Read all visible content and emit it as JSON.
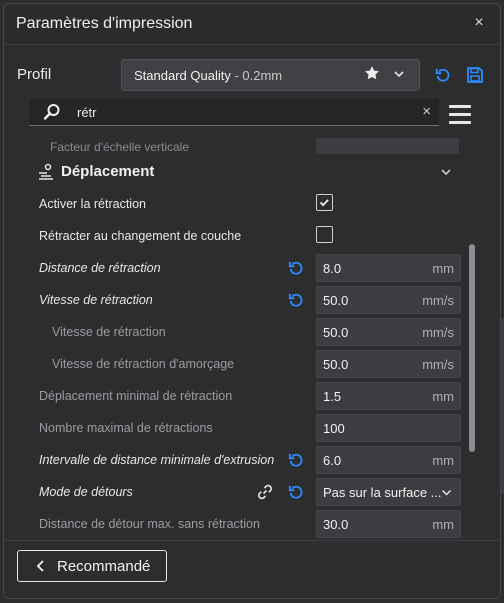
{
  "window": {
    "title": "Paramètres d'impression",
    "close_glyph": "×"
  },
  "profile": {
    "label": "Profil",
    "selected_name": "Standard Quality",
    "selected_suffix": " - 0.2mm",
    "icons": [
      "star-icon",
      "chevron-down-icon",
      "reset-icon",
      "save-icon"
    ]
  },
  "search": {
    "value": "rétr",
    "clear_glyph": "×"
  },
  "list": {
    "cut_off_label": "Facteur d'échelle verticale",
    "section_title": "Déplacement",
    "rows": [
      {
        "label": "Activer la rétraction",
        "checked": true
      },
      {
        "label": "Rétracter au changement de couche",
        "checked": false
      },
      {
        "label": "Distance de rétraction",
        "value": "8.0",
        "unit": "mm"
      },
      {
        "label": "Vitesse de rétraction",
        "value": "50.0",
        "unit": "mm/s"
      },
      {
        "label": "Vitesse de rétraction",
        "value": "50.0",
        "unit": "mm/s"
      },
      {
        "label": "Vitesse de rétraction d'amorçage",
        "value": "50.0",
        "unit": "mm/s"
      },
      {
        "label": "Déplacement minimal de rétraction",
        "value": "1.5",
        "unit": "mm"
      },
      {
        "label": "Nombre maximal de rétractions",
        "value": "100",
        "unit": ""
      },
      {
        "label": "Intervalle de distance minimale d'extrusion",
        "value": "6.0",
        "unit": "mm"
      },
      {
        "label": "Mode de détours",
        "value": "Pas sur la surface ..."
      },
      {
        "label": "Distance de détour max. sans rétraction",
        "value": "30.0",
        "unit": "mm"
      }
    ]
  },
  "footer": {
    "recommended_label": "Recommandé"
  },
  "colors": {
    "accent": "#2f8cff",
    "background": "#2c2d2f",
    "field": "#3c3d40"
  }
}
